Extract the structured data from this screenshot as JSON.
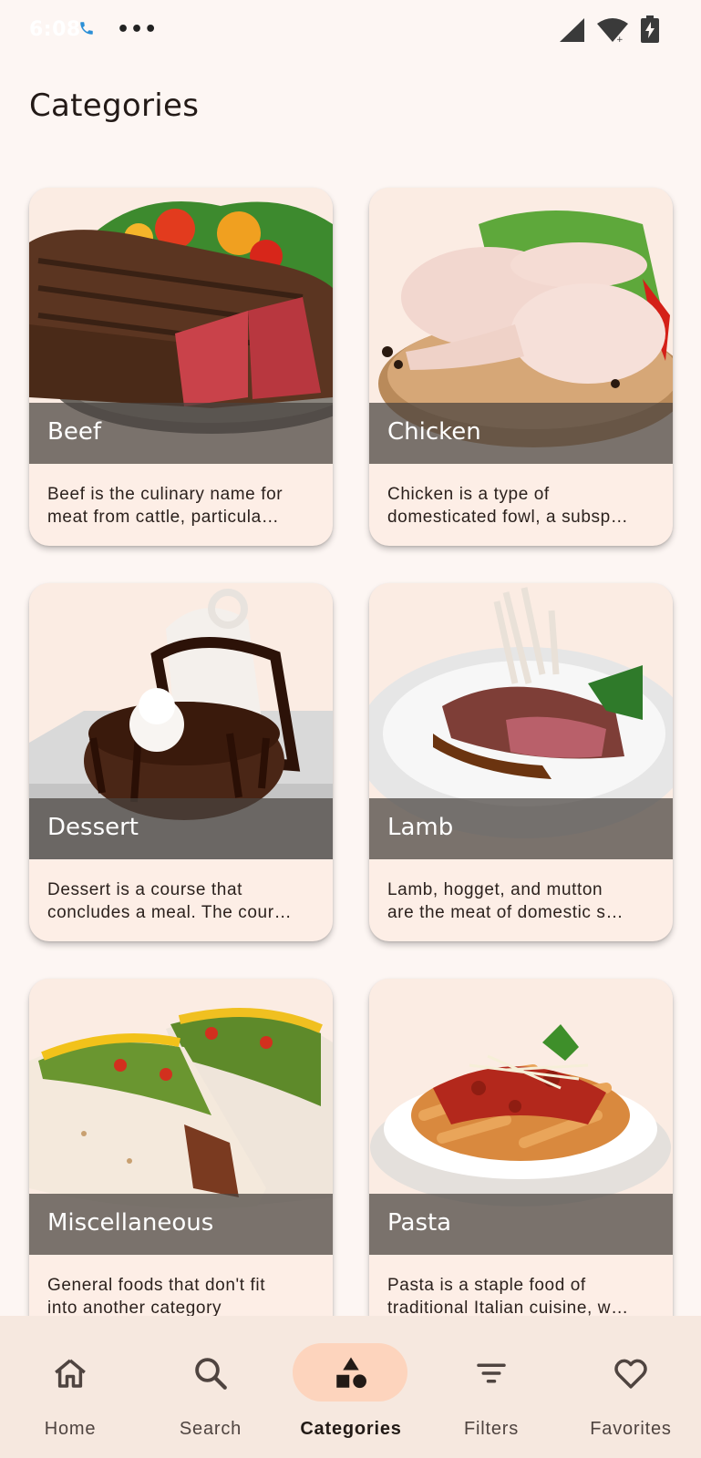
{
  "status_bar": {
    "time": "6:08",
    "overflow": "•••",
    "icons": [
      "phone-call-icon",
      "signal-icon",
      "wifi-icon",
      "battery-charging-icon"
    ]
  },
  "page": {
    "title": "Categories"
  },
  "categories": [
    {
      "name": "Beef",
      "desc_line1": "Beef is the culinary name for",
      "desc_line2": "meat from cattle, particula…"
    },
    {
      "name": "Chicken",
      "desc_line1": "Chicken is a type of",
      "desc_line2": "domesticated fowl, a subsp…"
    },
    {
      "name": "Dessert",
      "desc_line1": "Dessert is a course that",
      "desc_line2": "concludes a meal. The cour…"
    },
    {
      "name": "Lamb",
      "desc_line1": "Lamb, hogget, and mutton",
      "desc_line2": "are the meat of domestic s…"
    },
    {
      "name": "Miscellaneous",
      "desc_line1": "General foods that don't fit",
      "desc_line2": "into another category"
    },
    {
      "name": "Pasta",
      "desc_line1": "Pasta is a staple food of",
      "desc_line2": "traditional Italian cuisine, w…"
    }
  ],
  "bottom_nav": {
    "items": [
      {
        "label": "Home",
        "icon": "home-icon"
      },
      {
        "label": "Search",
        "icon": "search-icon"
      },
      {
        "label": "Categories",
        "icon": "categories-icon",
        "active": true
      },
      {
        "label": "Filters",
        "icon": "filter-icon"
      },
      {
        "label": "Favorites",
        "icon": "heart-icon"
      }
    ]
  },
  "colors": {
    "background": "#fdf6f3",
    "card": "#fdeee6",
    "nav_background": "#f6e8df",
    "nav_active_pill": "#fdd4bd"
  }
}
